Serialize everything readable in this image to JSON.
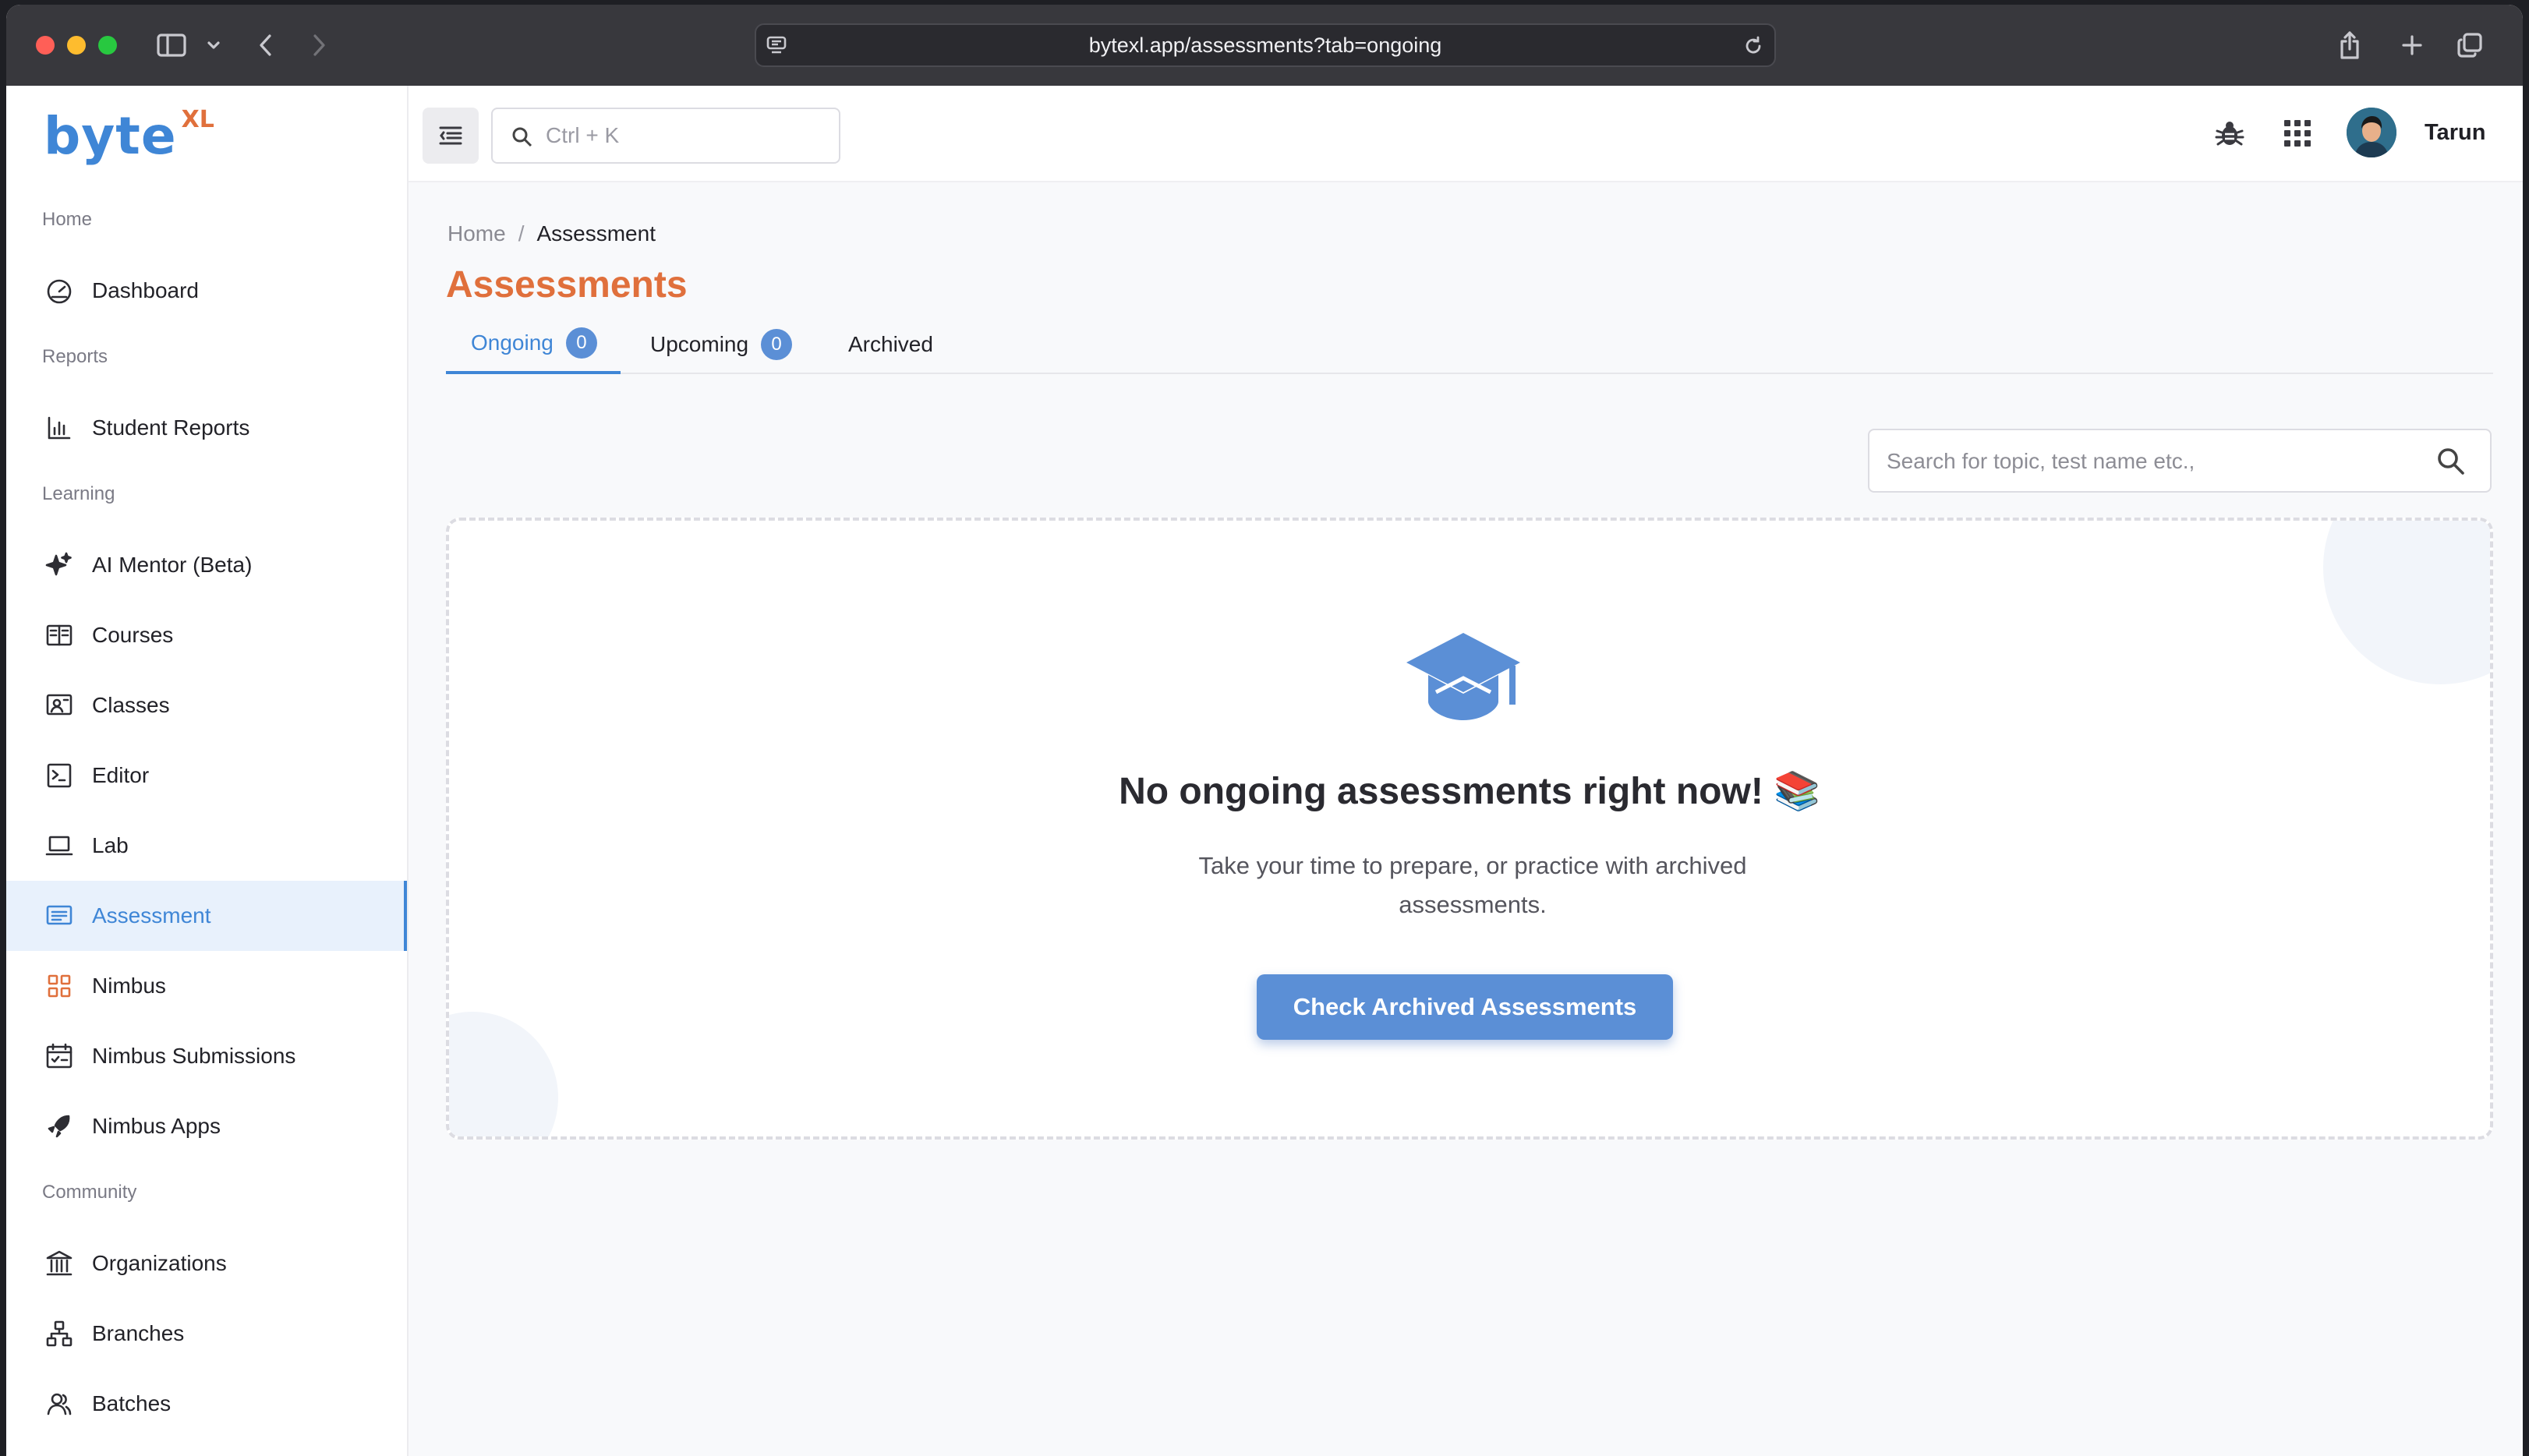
{
  "browser": {
    "url": "bytexl.app/assessments?tab=ongoing"
  },
  "logo": {
    "main": "byte",
    "sup": "XL"
  },
  "sidebar": {
    "sections": [
      {
        "label": "Home"
      },
      {
        "label": "Reports"
      },
      {
        "label": "Learning"
      },
      {
        "label": "Community"
      }
    ],
    "items": [
      {
        "label": "Dashboard",
        "icon": "speedometer-icon"
      },
      {
        "label": "Student Reports",
        "icon": "bar-chart-icon"
      },
      {
        "label": "AI Mentor (Beta)",
        "icon": "sparkles-icon"
      },
      {
        "label": "Courses",
        "icon": "book-open-icon"
      },
      {
        "label": "Classes",
        "icon": "classroom-icon"
      },
      {
        "label": "Editor",
        "icon": "terminal-icon"
      },
      {
        "label": "Lab",
        "icon": "laptop-icon"
      },
      {
        "label": "Assessment",
        "icon": "assessment-icon"
      },
      {
        "label": "Nimbus",
        "icon": "grid-icon"
      },
      {
        "label": "Nimbus Submissions",
        "icon": "calendar-check-icon"
      },
      {
        "label": "Nimbus Apps",
        "icon": "rocket-icon"
      },
      {
        "label": "Organizations",
        "icon": "bank-icon"
      },
      {
        "label": "Branches",
        "icon": "hierarchy-icon"
      },
      {
        "label": "Batches",
        "icon": "users-icon"
      }
    ],
    "active": "Assessment"
  },
  "topbar": {
    "search_placeholder": "Ctrl + K",
    "user_name": "Tarun"
  },
  "breadcrumb": {
    "home": "Home",
    "separator": "/",
    "current": "Assessment"
  },
  "page": {
    "title": "Assessments"
  },
  "tabs": [
    {
      "label": "Ongoing",
      "count": "0",
      "active": true
    },
    {
      "label": "Upcoming",
      "count": "0"
    },
    {
      "label": "Archived"
    }
  ],
  "search": {
    "placeholder": "Search for topic, test name etc.,"
  },
  "empty_state": {
    "title": "No ongoing assessments right now! 📚",
    "description": "Take your time to prepare, or practice with archived assessments.",
    "button": "Check Archived Assessments"
  },
  "colors": {
    "accent": "#3f86d6",
    "brand_orange": "#e0703c",
    "button": "#5b8fd6"
  }
}
